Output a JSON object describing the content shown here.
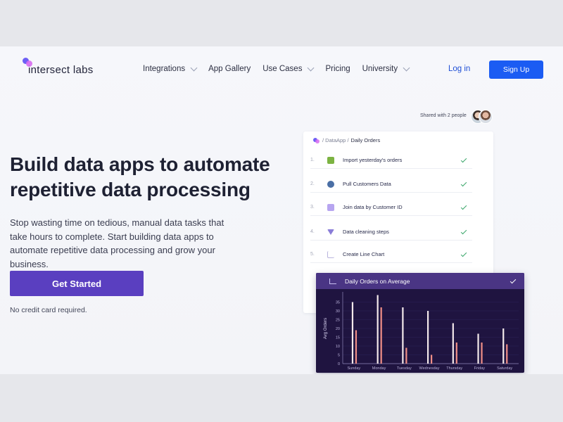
{
  "brand": {
    "name": "intersect labs"
  },
  "nav": {
    "items": [
      {
        "label": "Integrations",
        "has_dropdown": true
      },
      {
        "label": "App Gallery",
        "has_dropdown": false
      },
      {
        "label": "Use Cases",
        "has_dropdown": true
      },
      {
        "label": "Pricing",
        "has_dropdown": false
      },
      {
        "label": "University",
        "has_dropdown": true
      }
    ],
    "login_label": "Log in",
    "signup_label": "Sign Up"
  },
  "hero": {
    "title": "Build data apps to automate repetitive data processing",
    "subtitle": "Stop wasting time on tedious, manual data tasks that take hours to complete. Start building data apps to automate repetitive data processing and grow your business.",
    "cta_label": "Get Started",
    "note": "No credit card required."
  },
  "share": {
    "label": "Shared with 2 people"
  },
  "workflow": {
    "breadcrumb": {
      "path": "/ DataApp /",
      "current": "Daily Orders"
    },
    "steps": [
      {
        "num": "1.",
        "icon": "shopify-icon",
        "label": "Import yesterday's orders"
      },
      {
        "num": "2.",
        "icon": "database-icon",
        "label": "Pull Customers Data"
      },
      {
        "num": "3.",
        "icon": "join-icon",
        "label": "Join data by Customer ID"
      },
      {
        "num": "4.",
        "icon": "filter-icon",
        "label": "Data cleaning steps"
      },
      {
        "num": "5.",
        "icon": "line-chart-icon",
        "label": "Create Line Chart"
      }
    ]
  },
  "colors": {
    "primary_blue": "#1b5cf3",
    "cta_purple": "#5a3fc0",
    "chart_bg": "#1f1440",
    "chart_header": "#4a3584",
    "bar_light": "#f3e9ea",
    "bar_accent": "#f08e86",
    "check_green": "#3aa66a"
  },
  "chart_data": {
    "type": "bar",
    "title": "Daily Orders on Average",
    "ylabel": "Avg Orders",
    "xlabel": "",
    "ylim": [
      0,
      40
    ],
    "yticks": [
      0,
      5,
      10,
      15,
      20,
      25,
      30,
      35
    ],
    "categories": [
      "Sunday",
      "Monday",
      "Tuesday",
      "Wednesday",
      "Thursday",
      "Friday",
      "Saturday"
    ],
    "series": [
      {
        "values": [
          35,
          39,
          32,
          30,
          23,
          17,
          20
        ]
      },
      {
        "values": [
          19,
          32,
          9,
          5,
          12,
          12,
          11
        ]
      }
    ],
    "grid": true,
    "legend": "none"
  }
}
